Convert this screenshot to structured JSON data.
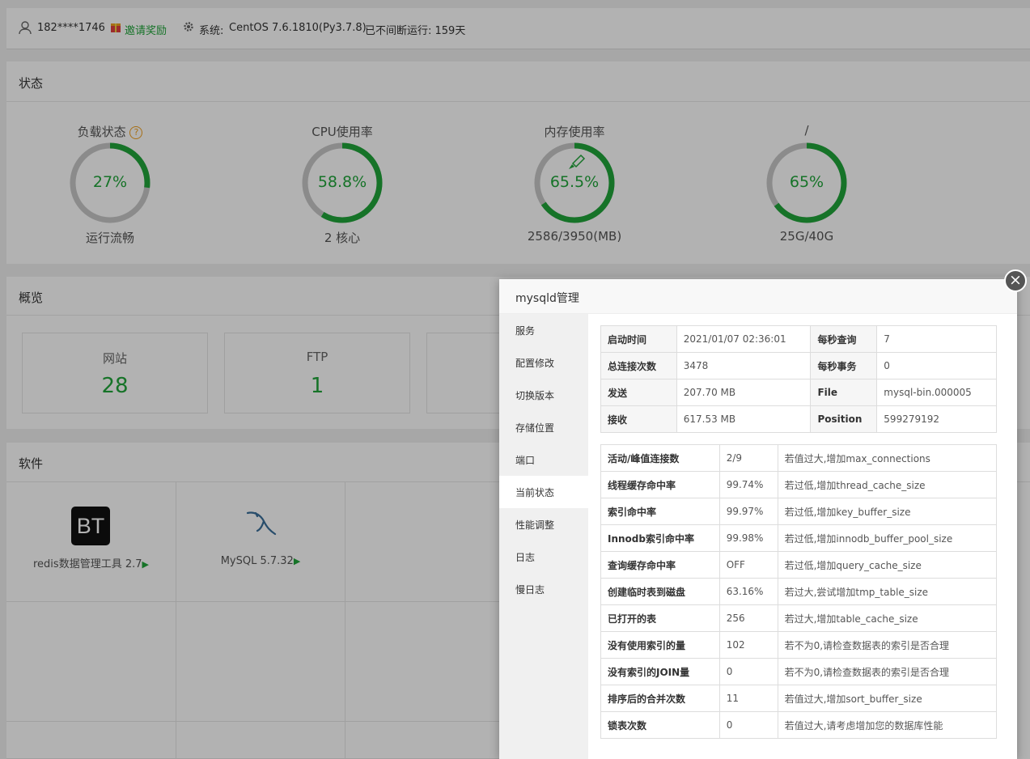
{
  "topbar": {
    "user": "182****1746",
    "invite": "邀请奖励",
    "system_label": "系统:",
    "system_value": "CentOS 7.6.1810(Py3.7.8)",
    "uptime": "已不间断运行: 159天"
  },
  "status": {
    "title": "状态",
    "gauges": [
      {
        "label": "负载状态",
        "value": "27%",
        "percent": 27,
        "sub": "运行流畅",
        "help": "?"
      },
      {
        "label": "CPU使用率",
        "value": "58.8%",
        "percent": 58.8,
        "sub": "2 核心"
      },
      {
        "label": "内存使用率",
        "value": "65.5%",
        "percent": 65.5,
        "sub": "2586/3950(MB)",
        "icon": "rocket-icon"
      },
      {
        "label": "/",
        "value": "65%",
        "percent": 65,
        "sub": "25G/40G"
      }
    ]
  },
  "overview": {
    "title": "概览",
    "boxes": [
      {
        "label": "网站",
        "value": "28"
      },
      {
        "label": "FTP",
        "value": "1"
      }
    ]
  },
  "software": {
    "title": "软件",
    "items": [
      {
        "name": "redis数据管理工具 2.7",
        "icon": "bt-logo-icon"
      },
      {
        "name": "MySQL 5.7.32",
        "icon": "mysql-dolphin-icon"
      }
    ]
  },
  "modal": {
    "title": "mysqld管理",
    "menu": [
      "服务",
      "配置修改",
      "切换版本",
      "存储位置",
      "端口",
      "当前状态",
      "性能调整",
      "日志",
      "慢日志"
    ],
    "active_menu": "当前状态",
    "summary": [
      [
        "启动时间",
        "2021/01/07 02:36:01",
        "每秒查询",
        "7"
      ],
      [
        "总连接次数",
        "3478",
        "每秒事务",
        "0"
      ],
      [
        "发送",
        "207.70 MB",
        "File",
        "mysql-bin.000005"
      ],
      [
        "接收",
        "617.53 MB",
        "Position",
        "599279192"
      ]
    ],
    "metrics": [
      [
        "活动/峰值连接数",
        "2/9",
        "若值过大,增加max_connections"
      ],
      [
        "线程缓存命中率",
        "99.74%",
        "若过低,增加thread_cache_size"
      ],
      [
        "索引命中率",
        "99.97%",
        "若过低,增加key_buffer_size"
      ],
      [
        "Innodb索引命中率",
        "99.98%",
        "若过低,增加innodb_buffer_pool_size"
      ],
      [
        "查询缓存命中率",
        "OFF",
        "若过低,增加query_cache_size"
      ],
      [
        "创建临时表到磁盘",
        "63.16%",
        "若过大,尝试增加tmp_table_size"
      ],
      [
        "已打开的表",
        "256",
        "若过大,增加table_cache_size"
      ],
      [
        "没有使用索引的量",
        "102",
        "若不为0,请检查数据表的索引是否合理"
      ],
      [
        "没有索引的JOIN量",
        "0",
        "若不为0,请检查数据表的索引是否合理"
      ],
      [
        "排序后的合并次数",
        "11",
        "若值过大,增加sort_buffer_size"
      ],
      [
        "锁表次数",
        "0",
        "若值过大,请考虑增加您的数据库性能"
      ]
    ]
  },
  "colors": {
    "accent": "#20a53a",
    "ring_bg": "#c8c8c8",
    "invite": "#20a53a",
    "help": "#f0a020"
  }
}
